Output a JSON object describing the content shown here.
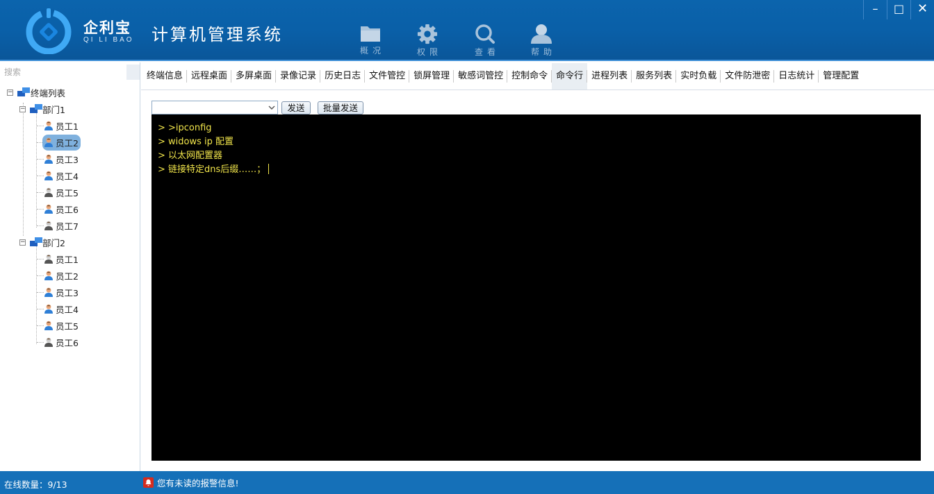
{
  "brand": {
    "name": "企利宝",
    "sub": "QI LI BAO",
    "app_title": "计算机管理系统"
  },
  "nav": [
    {
      "label": "概况",
      "icon": "folder-icon"
    },
    {
      "label": "权限",
      "icon": "gear-icon"
    },
    {
      "label": "查看",
      "icon": "search-icon"
    },
    {
      "label": "帮助",
      "icon": "user-icon"
    }
  ],
  "window_controls": {
    "minimize": "–",
    "maximize": "□",
    "close": "✕"
  },
  "sidebar": {
    "search_placeholder": "搜索",
    "root_label": "终端列表",
    "groups": [
      {
        "label": "部门1",
        "employees": [
          {
            "label": "员工1",
            "status": "online"
          },
          {
            "label": "员工2",
            "status": "online",
            "selected": true
          },
          {
            "label": "员工3",
            "status": "online"
          },
          {
            "label": "员工4",
            "status": "online"
          },
          {
            "label": "员工5",
            "status": "offline"
          },
          {
            "label": "员工6",
            "status": "online"
          },
          {
            "label": "员工7",
            "status": "offline"
          }
        ]
      },
      {
        "label": "部门2",
        "employees": [
          {
            "label": "员工1",
            "status": "offline"
          },
          {
            "label": "员工2",
            "status": "online"
          },
          {
            "label": "员工3",
            "status": "online"
          },
          {
            "label": "员工4",
            "status": "online"
          },
          {
            "label": "员工5",
            "status": "online"
          },
          {
            "label": "员工6",
            "status": "offline"
          }
        ]
      }
    ]
  },
  "tabs": [
    "终端信息",
    "远程桌面",
    "多屏桌面",
    "录像记录",
    "历史日志",
    "文件管控",
    "锁屏管理",
    "敏感词管控",
    "控制命令",
    "命令行",
    "进程列表",
    "服务列表",
    "实时负载",
    "文件防泄密",
    "日志统计",
    "管理配置"
  ],
  "active_tab": "命令行",
  "command": {
    "select_value": "",
    "send_label": "发送",
    "batch_send_label": "批量发送"
  },
  "console_lines": [
    "> >ipconfig",
    "> widows ip 配置",
    "> 以太网配置器",
    "> 链接特定dns后缀……；"
  ],
  "status": {
    "online_count": "在线数量：9/13",
    "alert_text": "您有未读的报警信息!"
  },
  "colors": {
    "header_blue": "#0a5fa7",
    "status_blue": "#1570b8",
    "console_text": "#f2e64b",
    "selected_item": "#7fb1de",
    "alert_red": "#d62c1e"
  }
}
